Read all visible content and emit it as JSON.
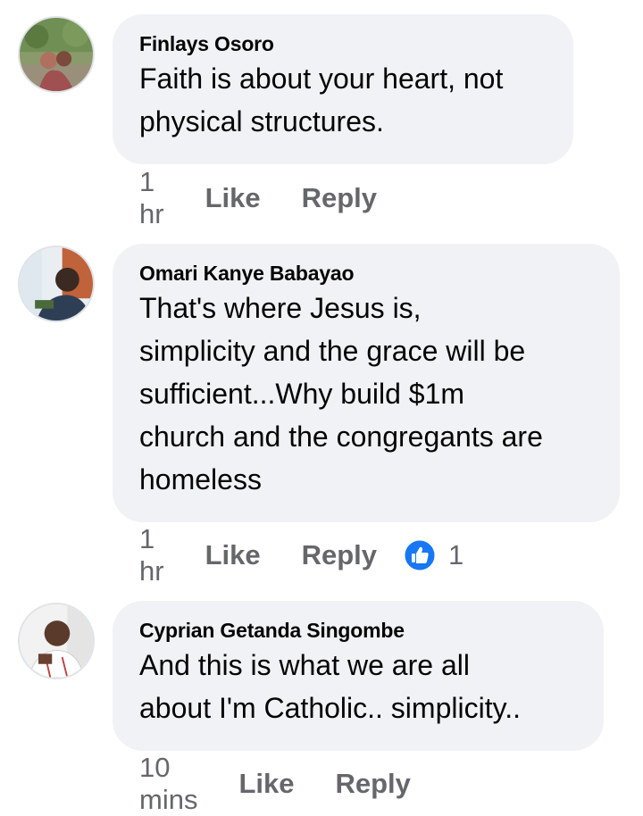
{
  "comments": [
    {
      "author": "Finlays Osoro",
      "text": "Faith is about your heart, not\nphysical structures.",
      "time": "1 hr",
      "like_label": "Like",
      "reply_label": "Reply"
    },
    {
      "author": "Omari Kanye Babayao",
      "text": "That's  where Jesus is,\nsimplicity and the grace will be\nsufficient...Why build $1m\nchurch and the congregants are\nhomeless",
      "time": "1 hr",
      "like_label": "Like",
      "reply_label": "Reply",
      "reaction_count": "1",
      "reaction_icon": "like-thumbs-up-icon",
      "reaction_color": "#1877f2"
    },
    {
      "author": "Cyprian Getanda Singombe",
      "text": "And this is what we are all\nabout I'm Catholic.. simplicity..",
      "time": "10 mins",
      "like_label": "Like",
      "reply_label": "Reply"
    }
  ],
  "colors": {
    "bubble_bg": "#f0f2f5",
    "text": "#050505",
    "meta": "#65676b",
    "accent": "#1877f2"
  }
}
